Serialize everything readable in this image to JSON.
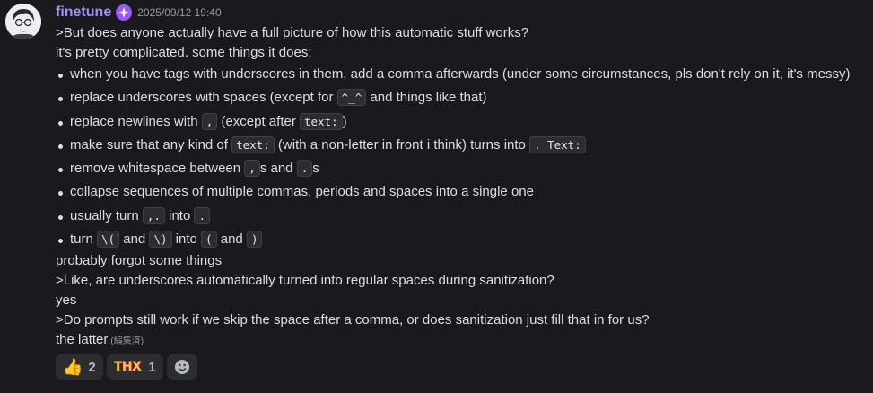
{
  "message": {
    "username": "finetune",
    "timestamp": "2025/09/12 19:40",
    "edited_label": "(編集済)",
    "lines_before": [
      ">But does anyone actually have a full picture of how this automatic stuff works?",
      "it's pretty complicated. some things it does:"
    ],
    "bullets": [
      {
        "parts": [
          {
            "t": "when you have tags with underscores in them, add a comma afterwards (under some circumstances, pls don't rely on it, it's messy)"
          }
        ]
      },
      {
        "parts": [
          {
            "t": "replace underscores with spaces (except for "
          },
          {
            "c": "^_^"
          },
          {
            "t": " and things like that)"
          }
        ]
      },
      {
        "parts": [
          {
            "t": "replace newlines with "
          },
          {
            "c": ","
          },
          {
            "t": " (except after "
          },
          {
            "c": "text:"
          },
          {
            "t": ")"
          }
        ]
      },
      {
        "parts": [
          {
            "t": "make sure that any kind of "
          },
          {
            "c": "text:"
          },
          {
            "t": " (with a non-letter in front i think) turns into "
          },
          {
            "c": ". Text:"
          }
        ]
      },
      {
        "parts": [
          {
            "t": "remove whitespace between "
          },
          {
            "c": ","
          },
          {
            "t": "s and "
          },
          {
            "c": "."
          },
          {
            "t": "s"
          }
        ]
      },
      {
        "parts": [
          {
            "t": "collapse sequences of multiple commas, periods and spaces into a single one"
          }
        ]
      },
      {
        "parts": [
          {
            "t": "usually turn "
          },
          {
            "c": ",."
          },
          {
            "t": " into "
          },
          {
            "c": "."
          }
        ]
      },
      {
        "parts": [
          {
            "t": "turn "
          },
          {
            "c": "\\("
          },
          {
            "t": " and "
          },
          {
            "c": "\\)"
          },
          {
            "t": " into "
          },
          {
            "c": "("
          },
          {
            "t": " and "
          },
          {
            "c": ")"
          }
        ]
      }
    ],
    "lines_after": [
      "probably forgot some things",
      ">Like, are underscores automatically turned into regular spaces during sanitization?",
      "yes",
      ">Do prompts still work if we skip the space after a comma, or does sanitization just fill that in for us?",
      "the latter"
    ]
  },
  "reactions": [
    {
      "icon": "thumbs-up-icon",
      "emoji": "👍",
      "count": "2"
    },
    {
      "icon": "thx-icon",
      "label": "THX",
      "count": "1"
    }
  ],
  "add_reaction_icon": "smiley-icon",
  "colors": {
    "username": "#a78bfa",
    "background": "#1a1a1e"
  }
}
